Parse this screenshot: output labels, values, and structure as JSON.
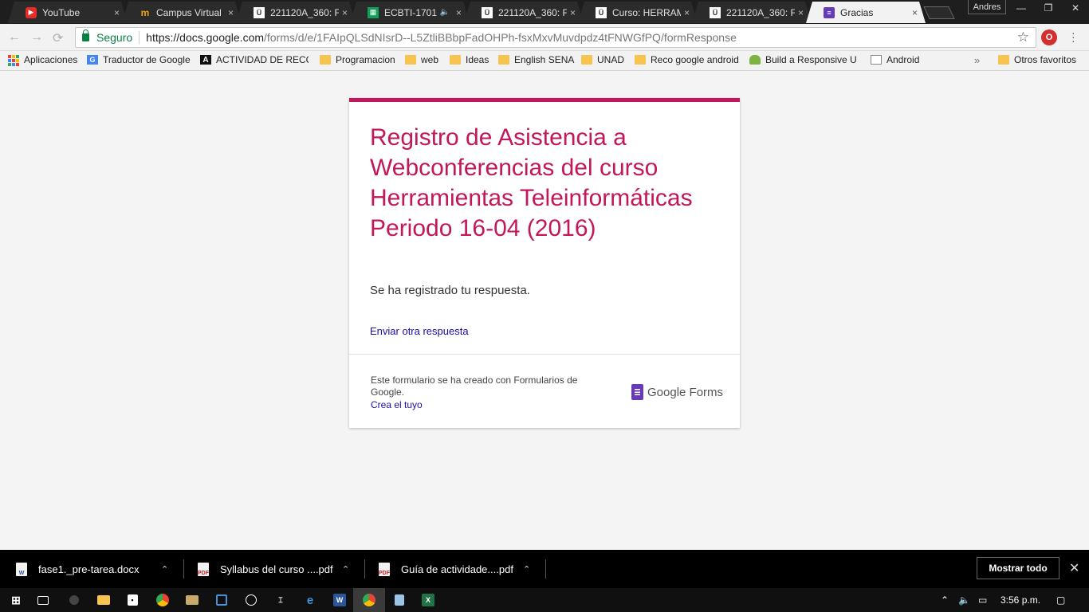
{
  "browser": {
    "tabs": [
      {
        "title": "YouTube",
        "icon": "youtube-icon",
        "active": false
      },
      {
        "title": "Campus Virtual",
        "icon": "campus-icon",
        "active": false
      },
      {
        "title": "221120A_360: F",
        "icon": "unad-icon",
        "active": false
      },
      {
        "title": "ECBTI-1701",
        "icon": "sheet-icon",
        "active": false,
        "audio": true
      },
      {
        "title": "221120A_360: F",
        "icon": "unad-icon",
        "active": false
      },
      {
        "title": "Curso: HERRAM",
        "icon": "unad-icon",
        "active": false
      },
      {
        "title": "221120A_360: F",
        "icon": "unad-icon",
        "active": false
      },
      {
        "title": "Gracias",
        "icon": "forms-icon",
        "active": true
      }
    ],
    "close_glyph": "×",
    "profile_name": "Andres",
    "window": {
      "minimize": "—",
      "restore": "❐",
      "close": "✕"
    }
  },
  "omnibox": {
    "secure_label": "Seguro",
    "url_host": "https://docs.google.com",
    "url_path": "/forms/d/e/1FAIpQLSdNIsrD--L5ZtliBBbpFadOHPh-fsxMxvMuvdpdz4tFNWGfPQ/formResponse",
    "star_glyph": "☆",
    "nav": {
      "back": "←",
      "forward": "→",
      "reload": "⟳"
    },
    "extension_label": "O"
  },
  "bookmarks": {
    "items": [
      {
        "label": "Aplicaciones",
        "icon": "apps-icon"
      },
      {
        "label": "Traductor de Google",
        "icon": "translate-icon"
      },
      {
        "label": "ACTIVIDAD DE RECON",
        "icon": "a-icon"
      },
      {
        "label": "Programacion",
        "icon": "folder-icon"
      },
      {
        "label": "web",
        "icon": "folder-icon"
      },
      {
        "label": "Ideas",
        "icon": "folder-icon"
      },
      {
        "label": "English SENA",
        "icon": "folder-icon"
      },
      {
        "label": "UNAD",
        "icon": "folder-icon"
      },
      {
        "label": "Reco google android",
        "icon": "folder-icon"
      },
      {
        "label": "Build a Responsive UI",
        "icon": "android-icon"
      },
      {
        "label": "Android",
        "icon": "page-icon"
      }
    ],
    "overflow_glyph": "»",
    "other_label": "Otros favoritos"
  },
  "form": {
    "title": "Registro de Asistencia a Webconferencias del curso Herramientas Teleinformáticas Periodo 16-04 (2016)",
    "confirmation": "Se ha registrado tu respuesta.",
    "another_response_link": "Enviar otra respuesta",
    "footer_text": "Este formulario se ha creado con Formularios de Google.",
    "footer_link": "Crea el tuyo",
    "brand": "Google Forms",
    "accent_color": "#c2185b"
  },
  "downloads": {
    "items": [
      {
        "name": "fase1._pre-tarea.docx",
        "type": "W"
      },
      {
        "name": "Syllabus del curso ....pdf",
        "type": "PDF"
      },
      {
        "name": "Guía de actividade....pdf",
        "type": "PDF"
      }
    ],
    "caret_glyph": "⌃",
    "show_all_label": "Mostrar todo",
    "close_glyph": "✕"
  },
  "taskbar": {
    "clock": "3:56 p.m.",
    "apps": [
      "start-icon",
      "task-view-icon",
      "firefox-icon",
      "explorer-icon",
      "store-icon",
      "chrome-icon",
      "photos-icon",
      "app-icon",
      "sync-icon",
      "terminal-icon",
      "edge-icon",
      "word-icon",
      "chrome-active-icon",
      "notes-icon",
      "excel-icon"
    ]
  }
}
